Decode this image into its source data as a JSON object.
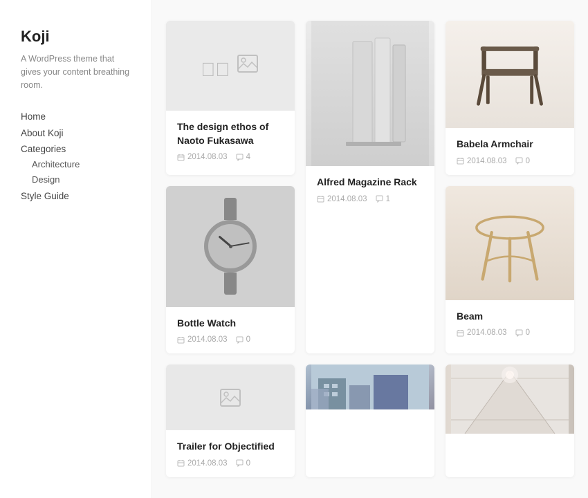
{
  "sidebar": {
    "logo": "Koji",
    "tagline": "A WordPress theme that gives your content breathing room.",
    "nav": [
      {
        "label": "Home",
        "href": "#"
      },
      {
        "label": "About Koji",
        "href": "#"
      },
      {
        "label": "Categories",
        "isSection": true
      },
      {
        "label": "Style Guide",
        "href": "#"
      }
    ],
    "categories": [
      {
        "label": "Architecture",
        "href": "#"
      },
      {
        "label": "Design",
        "href": "#"
      }
    ]
  },
  "cards": [
    {
      "id": "design-ethos",
      "title": "The design ethos of Naoto Fukasawa",
      "date": "2014.08.03",
      "comments": "4",
      "imageType": "placeholder",
      "column": 1
    },
    {
      "id": "alfred-magazine-rack",
      "title": "Alfred Magazine Rack",
      "date": "2014.08.03",
      "comments": "1",
      "imageType": "rack",
      "column": 2
    },
    {
      "id": "babela-armchair",
      "title": "Babela Armchair",
      "date": "2014.08.03",
      "comments": "0",
      "imageType": "chair",
      "column": 3
    },
    {
      "id": "bottle-watch",
      "title": "Bottle Watch",
      "date": "2014.08.03",
      "comments": "0",
      "imageType": "watch",
      "column": 1
    },
    {
      "id": "beam",
      "title": "Beam",
      "date": "2014.08.03",
      "comments": "0",
      "imageType": "stool",
      "column": 2
    },
    {
      "id": "trailer-objectified",
      "title": "Trailer for Objectified",
      "date": "2014.08.03",
      "comments": "0",
      "imageType": "trailer-placeholder",
      "column": 3
    },
    {
      "id": "architecture-building",
      "title": "",
      "date": "",
      "comments": "",
      "imageType": "building",
      "column": 1
    },
    {
      "id": "corridor",
      "title": "",
      "date": "",
      "comments": "",
      "imageType": "corridor",
      "column": 3
    }
  ],
  "icons": {
    "calendar": "🗓",
    "comment": "💬",
    "placeholder": "🖼"
  }
}
